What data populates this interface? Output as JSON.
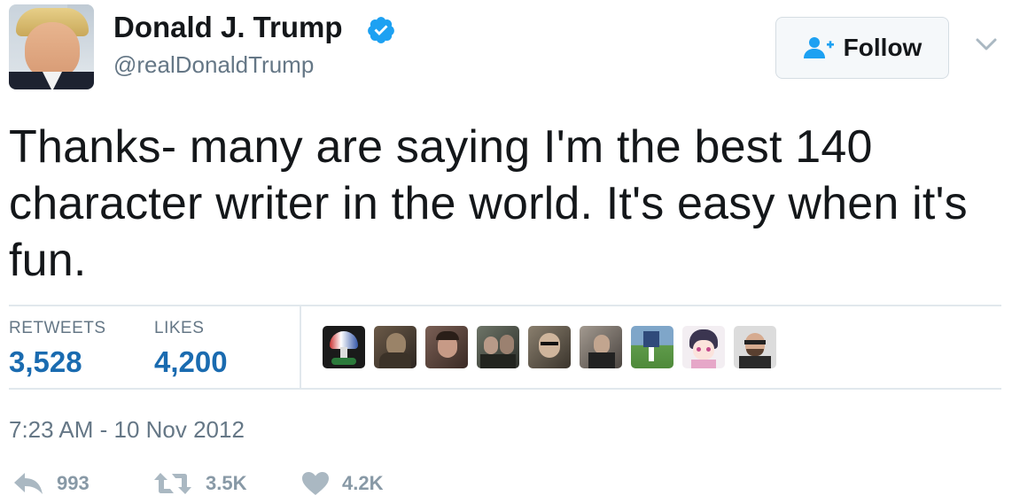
{
  "author": {
    "display_name": "Donald J. Trump",
    "handle": "@realDonaldTrump",
    "verified": true,
    "avatar_icon": "profile-photo"
  },
  "follow": {
    "label": "Follow",
    "icon": "add-user-icon"
  },
  "tweet": {
    "text": "Thanks- many are saying I'm the best 140 character writer in the world. It's easy when it's fun."
  },
  "stats": {
    "retweets_label": "RETWEETS",
    "retweets_value": "3,528",
    "likes_label": "LIKES",
    "likes_value": "4,200"
  },
  "liked_by": [
    {
      "icon": "liker-avatar-1"
    },
    {
      "icon": "liker-avatar-2"
    },
    {
      "icon": "liker-avatar-3"
    },
    {
      "icon": "liker-avatar-4"
    },
    {
      "icon": "liker-avatar-5"
    },
    {
      "icon": "liker-avatar-6"
    },
    {
      "icon": "liker-avatar-7"
    },
    {
      "icon": "liker-avatar-8"
    },
    {
      "icon": "liker-avatar-9"
    }
  ],
  "timestamp": "7:23 AM - 10 Nov 2012",
  "actions": {
    "reply_count": "993",
    "retweet_count": "3.5K",
    "like_count": "4.2K"
  },
  "colors": {
    "text": "#14171a",
    "secondary": "#657786",
    "stat_value": "#1a6bb0",
    "verified": "#1da1f2",
    "divider": "#e1e8ed",
    "action_icon": "#aab8c2"
  }
}
